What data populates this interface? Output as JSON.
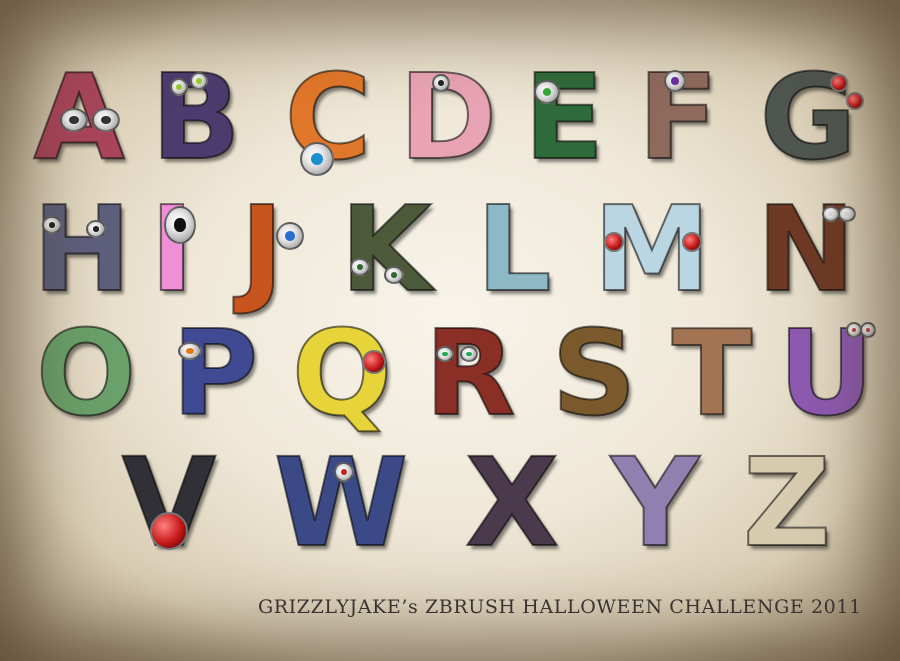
{
  "colors": {
    "background": "#efe8d8",
    "vignette": "#8f7c62",
    "caption": "#3a3330"
  },
  "letters": [
    {
      "char": "A",
      "color": "#a8455a"
    },
    {
      "char": "B",
      "color": "#4c3c6e"
    },
    {
      "char": "C",
      "color": "#e0772a"
    },
    {
      "char": "D",
      "color": "#e8a3b4"
    },
    {
      "char": "E",
      "color": "#2f6a3a"
    },
    {
      "char": "F",
      "color": "#8d6a5c"
    },
    {
      "char": "G",
      "color": "#4f5650"
    },
    {
      "char": "H",
      "color": "#5e5f7c"
    },
    {
      "char": "I",
      "color": "#f08ed8"
    },
    {
      "char": "J",
      "color": "#c8541e"
    },
    {
      "char": "K",
      "color": "#4d5a3a"
    },
    {
      "char": "L",
      "color": "#8db8c6"
    },
    {
      "char": "M",
      "color": "#b9d6e2"
    },
    {
      "char": "N",
      "color": "#6e3a25"
    },
    {
      "char": "O",
      "color": "#6aa06a"
    },
    {
      "char": "P",
      "color": "#3f4a92"
    },
    {
      "char": "Q",
      "color": "#e6d43a"
    },
    {
      "char": "R",
      "color": "#8a2f26"
    },
    {
      "char": "S",
      "color": "#7a5a2c"
    },
    {
      "char": "T",
      "color": "#a27454"
    },
    {
      "char": "U",
      "color": "#8d5ab0"
    },
    {
      "char": "V",
      "color": "#303036"
    },
    {
      "char": "W",
      "color": "#3b4a86"
    },
    {
      "char": "X",
      "color": "#4a3a4c"
    },
    {
      "char": "Y",
      "color": "#9080b0"
    },
    {
      "char": "Z",
      "color": "#d8ccb0"
    }
  ],
  "caption": "GRIZZLYJAKE’s ZBRUSH HALLOWEEN CHALLENGE 2011"
}
